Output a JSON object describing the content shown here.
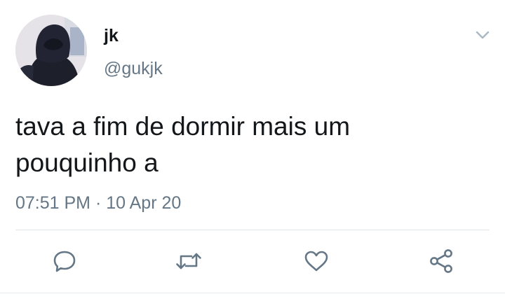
{
  "user": {
    "display_name": "jk",
    "handle": "@gukjk"
  },
  "tweet": {
    "text": "tava a fim de dormir mais um pouquinho a",
    "time": "07:51 PM",
    "separator": "·",
    "date": "10 Apr 20"
  },
  "actions": {
    "reply": "reply-icon",
    "retweet": "retweet-icon",
    "like": "heart-icon",
    "share": "share-icon"
  },
  "colors": {
    "primary_text": "#14171a",
    "secondary_text": "#657786",
    "icon": "#657786",
    "divider": "#dfe4e8"
  }
}
